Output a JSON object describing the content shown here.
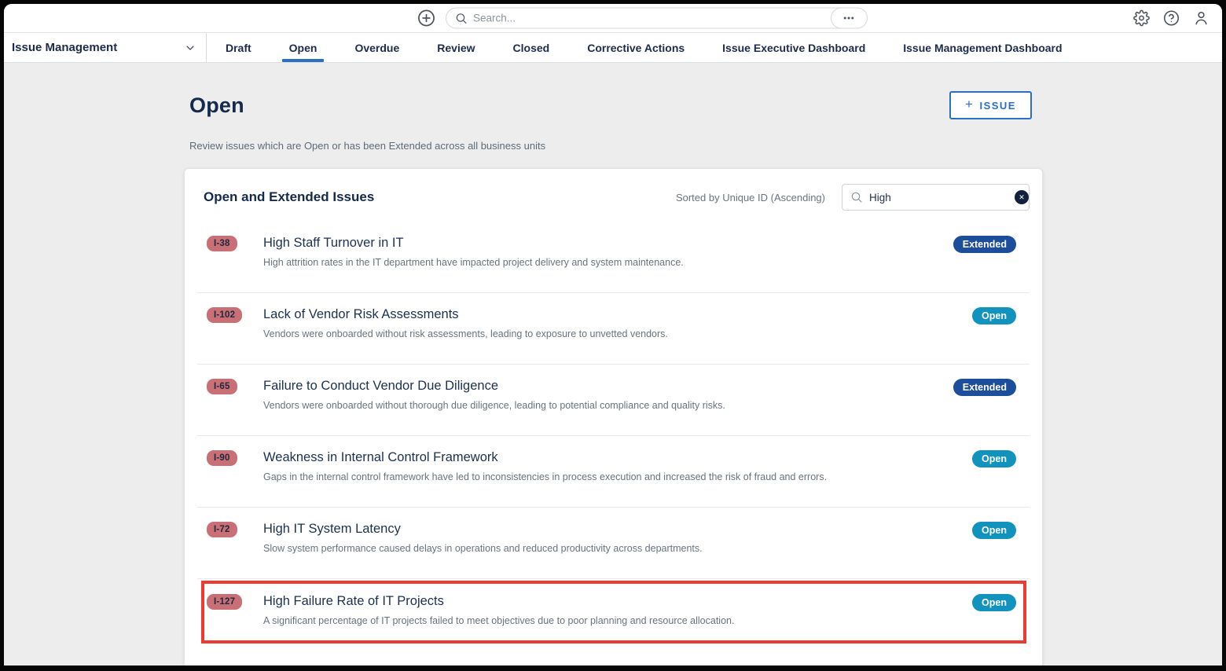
{
  "topbar": {
    "search_placeholder": "Search...",
    "overflow_glyph": "•••",
    "icons": {
      "add": "plus-circle",
      "search": "magnifier",
      "overflow": "ellipsis",
      "settings": "gear",
      "help": "question-circle",
      "account": "person"
    }
  },
  "navbar": {
    "module_label": "Issue Management",
    "module_dropdown_icon": "chevron-down",
    "tabs": [
      {
        "label": "Draft",
        "active": false
      },
      {
        "label": "Open",
        "active": true
      },
      {
        "label": "Overdue",
        "active": false
      },
      {
        "label": "Review",
        "active": false
      },
      {
        "label": "Closed",
        "active": false
      },
      {
        "label": "Corrective Actions",
        "active": false
      },
      {
        "label": "Issue Executive Dashboard",
        "active": false
      },
      {
        "label": "Issue Management Dashboard",
        "active": false
      }
    ]
  },
  "page": {
    "title": "Open",
    "subtitle": "Review issues which are Open or has been Extended across all business units",
    "new_issue_plus": "+",
    "new_issue_button": "ISSUE"
  },
  "card": {
    "title": "Open and Extended Issues",
    "sort_label": "Sorted by Unique ID (Ascending)",
    "filter_value": "High",
    "clear_glyph": "✕",
    "issues": [
      {
        "id": "I-38",
        "title": "High Staff Turnover in IT",
        "description": "High attrition rates in the IT department have impacted project delivery and system maintenance.",
        "status": "Extended",
        "highlighted": false
      },
      {
        "id": "I-102",
        "title": "Lack of Vendor Risk Assessments",
        "description": "Vendors were onboarded without risk assessments, leading to exposure to unvetted vendors.",
        "status": "Open",
        "highlighted": false
      },
      {
        "id": "I-65",
        "title": "Failure to Conduct Vendor Due Diligence",
        "description": "Vendors were onboarded without thorough due diligence, leading to potential compliance and quality risks.",
        "status": "Extended",
        "highlighted": false
      },
      {
        "id": "I-90",
        "title": "Weakness in Internal Control Framework",
        "description": "Gaps in the internal control framework have led to inconsistencies in process execution and increased the risk of fraud and errors.",
        "status": "Open",
        "highlighted": false
      },
      {
        "id": "I-72",
        "title": "High IT System Latency",
        "description": "Slow system performance caused delays in operations and reduced productivity across departments.",
        "status": "Open",
        "highlighted": false
      },
      {
        "id": "I-127",
        "title": "High Failure Rate of IT Projects",
        "description": "A significant percentage of IT projects failed to meet objectives due to poor planning and resource allocation.",
        "status": "Open",
        "highlighted": true
      }
    ]
  },
  "colors": {
    "accent_blue": "#2b6fc5",
    "status_open": "#1193bd",
    "status_extended": "#1d4e9b",
    "id_badge_bg": "#c96f76",
    "highlight_red": "#ee3b30",
    "background_gray": "#ededee"
  }
}
